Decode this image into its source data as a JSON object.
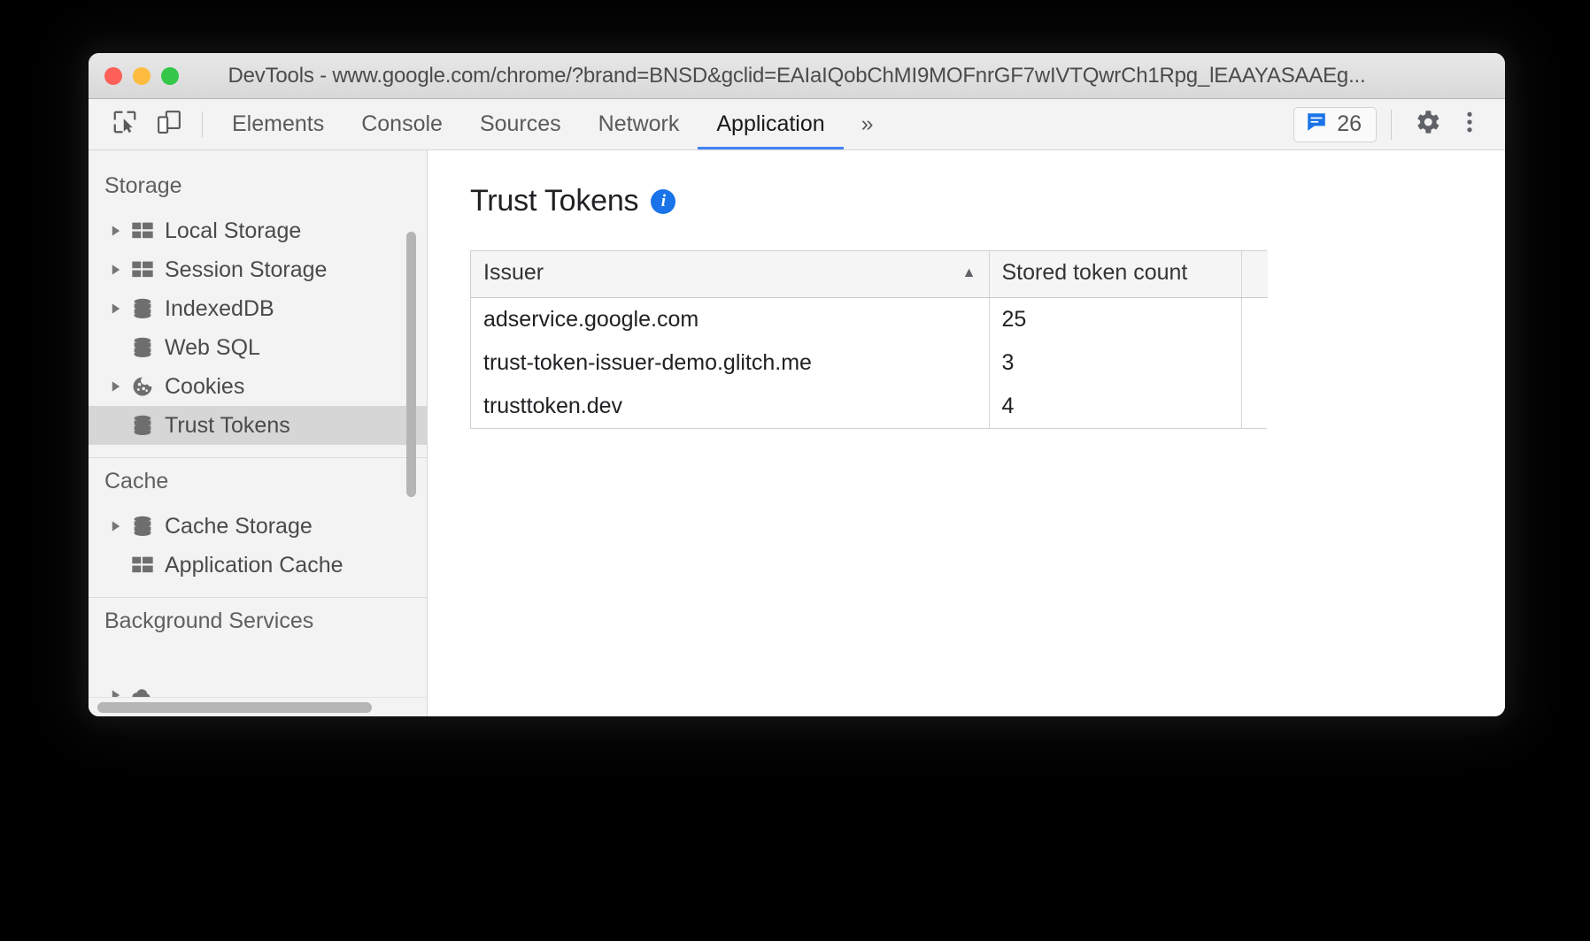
{
  "window": {
    "title": "DevTools - www.google.com/chrome/?brand=BNSD&gclid=EAIaIQobChMI9MOFnrGF7wIVTQwrCh1Rpg_lEAAYASAAEg...",
    "traffic_lights": {
      "close": "close-window-button",
      "minimize": "minimize-window-button",
      "maximize": "maximize-window-button"
    },
    "colors": {
      "close": "#fc6058",
      "minimize": "#fdbc40",
      "maximize": "#34c749"
    }
  },
  "toolbar": {
    "inspect_icon": "inspect-element-icon",
    "device_icon": "device-toolbar-icon",
    "tabs": [
      {
        "label": "Elements",
        "active": false
      },
      {
        "label": "Console",
        "active": false
      },
      {
        "label": "Sources",
        "active": false
      },
      {
        "label": "Network",
        "active": false
      },
      {
        "label": "Application",
        "active": true
      }
    ],
    "more_tabs_label": "»",
    "message_count": "26",
    "message_icon": "message-bubble-icon",
    "settings_icon": "gear-icon",
    "menu_icon": "kebab-menu-icon",
    "accent_color": "#4285f4",
    "message_icon_color": "#1a73e8"
  },
  "sidebar": {
    "sections": [
      {
        "title": "Storage",
        "items": [
          {
            "label": "Local Storage",
            "icon": "table-icon",
            "expandable": true,
            "selected": false
          },
          {
            "label": "Session Storage",
            "icon": "table-icon",
            "expandable": true,
            "selected": false
          },
          {
            "label": "IndexedDB",
            "icon": "database-icon",
            "expandable": true,
            "selected": false
          },
          {
            "label": "Web SQL",
            "icon": "database-icon",
            "expandable": false,
            "selected": false
          },
          {
            "label": "Cookies",
            "icon": "cookie-icon",
            "expandable": true,
            "selected": false
          },
          {
            "label": "Trust Tokens",
            "icon": "database-icon",
            "expandable": false,
            "selected": true
          }
        ]
      },
      {
        "title": "Cache",
        "items": [
          {
            "label": "Cache Storage",
            "icon": "database-icon",
            "expandable": true,
            "selected": false
          },
          {
            "label": "Application Cache",
            "icon": "table-icon",
            "expandable": false,
            "selected": false
          }
        ]
      },
      {
        "title": "Background Services",
        "items": []
      }
    ],
    "selected_highlight_color": "#d6d6d6"
  },
  "content": {
    "title": "Trust Tokens",
    "info_icon": "info-icon",
    "info_icon_color": "#1a73e8",
    "table": {
      "columns": [
        {
          "label": "Issuer",
          "sorted": true,
          "sort_direction": "ascending",
          "sort_glyph": "▲"
        },
        {
          "label": "Stored token count",
          "sorted": false,
          "sort_direction": "",
          "sort_glyph": ""
        }
      ],
      "rows": [
        {
          "issuer": "adservice.google.com",
          "count": "25"
        },
        {
          "issuer": "trust-token-issuer-demo.glitch.me",
          "count": "3"
        },
        {
          "issuer": "trusttoken.dev",
          "count": "4"
        }
      ]
    }
  },
  "scrollbars": {
    "sidebar_vertical": "sidebar-vertical-scrollbar",
    "sidebar_horizontal": "sidebar-horizontal-scrollbar"
  }
}
